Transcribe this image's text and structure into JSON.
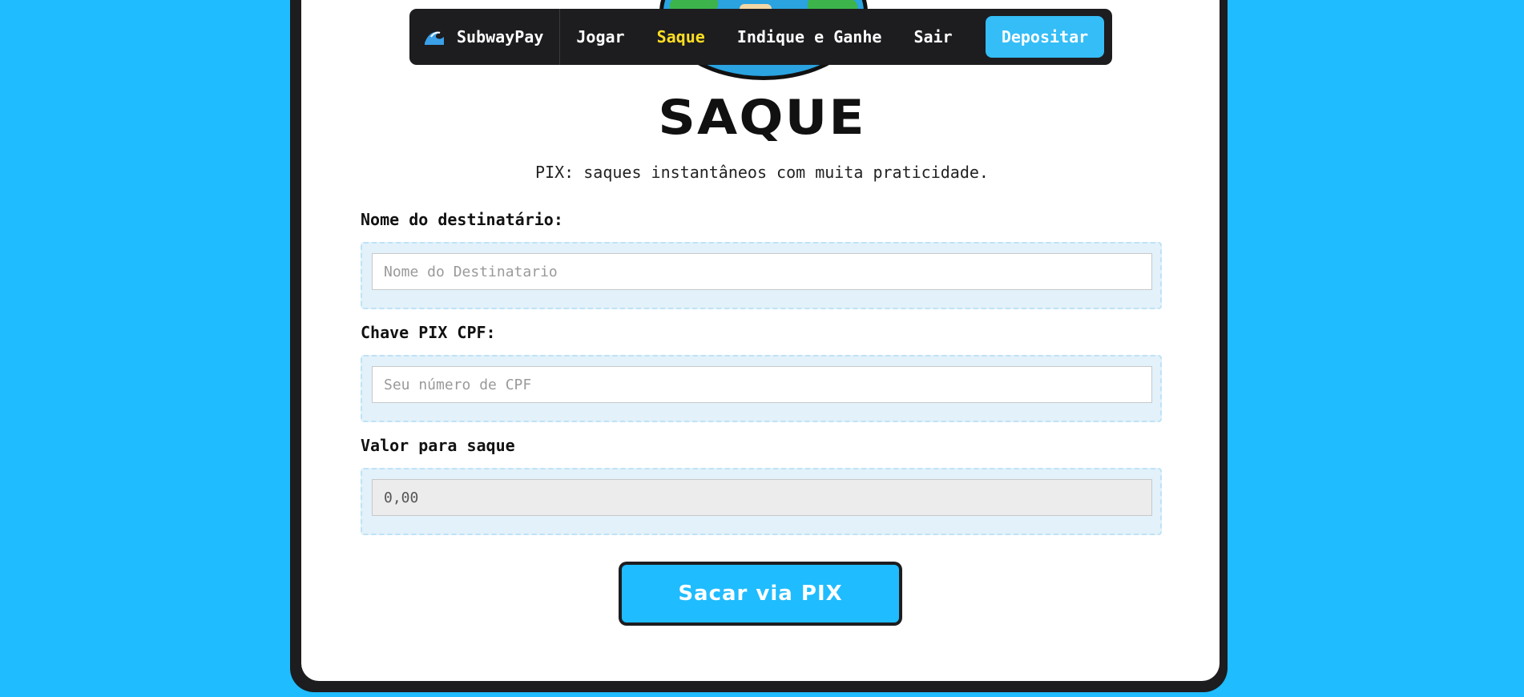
{
  "nav": {
    "brand": "SubwayPay",
    "links": [
      "Jogar",
      "Saque",
      "Indique e Ganhe",
      "Sair"
    ],
    "active": "Saque",
    "deposit_label": "Depositar"
  },
  "page": {
    "title": "SAQUE",
    "subtitle": "PIX: saques instantâneos com muita praticidade."
  },
  "form": {
    "name_label": "Nome do destinatário:",
    "name_placeholder": "Nome do Destinatario",
    "cpf_label": "Chave PIX CPF:",
    "cpf_placeholder": "Seu número de CPF",
    "amount_label": "Valor para saque",
    "amount_value": "0,00",
    "submit_label": "Sacar via PIX"
  },
  "colors": {
    "background": "#1fbcff",
    "accent": "#34bdf7",
    "active_link": "#ffde21",
    "nav_bg": "#1d1d20"
  }
}
